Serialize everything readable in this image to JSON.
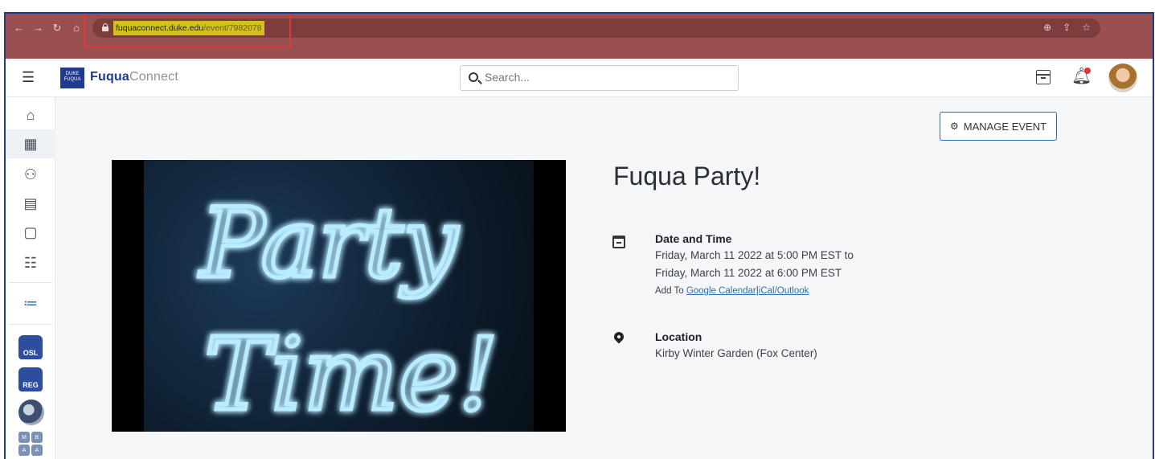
{
  "browser": {
    "url_host": "fuquaconnect.duke.edu",
    "url_path": "/event/7982078",
    "nav_icons": [
      "back-icon",
      "forward-icon",
      "reload-icon",
      "home-icon"
    ],
    "omnibox_icons": [
      "zoom-icon",
      "share-icon",
      "bookmark-star-icon"
    ]
  },
  "header": {
    "logo_text_line1": "DUKE",
    "logo_text_line2": "FUQUA",
    "brand_part1": "Fuqua",
    "brand_part2": "Connect",
    "search_placeholder": "Search..."
  },
  "sidebar": {
    "items": [
      {
        "name": "home-icon",
        "glyph": "⌂"
      },
      {
        "name": "calendar-icon",
        "glyph": "▦",
        "active": true
      },
      {
        "name": "people-icon",
        "glyph": "👥"
      },
      {
        "name": "document-icon",
        "glyph": "▤"
      },
      {
        "name": "form-icon",
        "glyph": "▢"
      },
      {
        "name": "filters-icon",
        "glyph": "☰"
      },
      {
        "name": "list-icon",
        "glyph": "≔"
      }
    ],
    "badges": [
      "OSL",
      "REG"
    ],
    "grid_letters": [
      "M",
      "B",
      "A",
      "A"
    ]
  },
  "event": {
    "manage_label": "MANAGE EVENT",
    "title": "Fuqua Party!",
    "date_label": "Date and Time",
    "date_line1": "Friday, March 11 2022 at 5:00 PM EST to",
    "date_line2": "Friday, March 11 2022 at 6:00 PM EST",
    "add_to_prefix": "Add To",
    "google_calendar": "Google Calendar",
    "separator": "|",
    "ical_outlook": "iCal/Outlook",
    "location_label": "Location",
    "location_value": "Kirby Winter Garden (Fox Center)",
    "image_text_1": "Party",
    "image_text_2": "Time!"
  },
  "colors": {
    "chrome": "#9a5050",
    "brand": "#1f3b8f",
    "link": "#2f6fb0",
    "neon": "#7fd8ff",
    "highlight": "#d4c21a",
    "annotation": "#e0363c"
  }
}
